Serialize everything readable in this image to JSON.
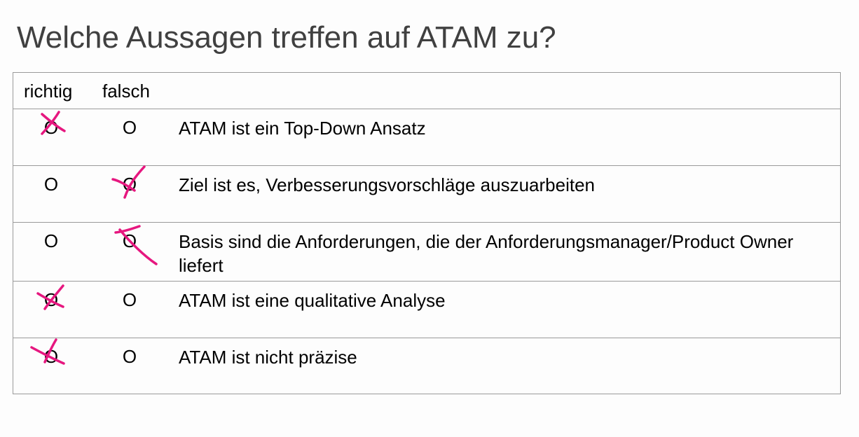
{
  "title": "Welche Aussagen treffen auf ATAM zu?",
  "table": {
    "headers": {
      "richtig": "richtig",
      "falsch": "falsch"
    },
    "option_symbol": "O",
    "mark_color": "#e6177f",
    "rows": [
      {
        "statement": "ATAM ist ein Top-Down Ansatz",
        "marked": "richtig"
      },
      {
        "statement": "Ziel ist es, Verbesserungsvorschläge auszuarbeiten",
        "marked": "falsch"
      },
      {
        "statement": "Basis sind die Anforderungen, die der Anforderungsmanager/Product Owner liefert",
        "marked": "falsch"
      },
      {
        "statement": "ATAM ist eine qualitative Analyse",
        "marked": "richtig"
      },
      {
        "statement": "ATAM ist nicht präzise",
        "marked": "richtig"
      }
    ]
  }
}
